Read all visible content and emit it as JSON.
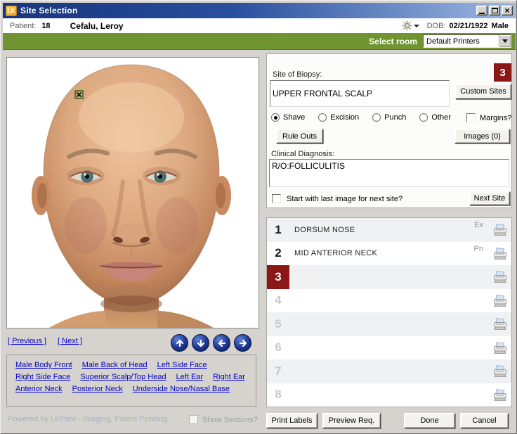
{
  "window": {
    "title": "Site Selection",
    "app_icon_text": "LK"
  },
  "patient_bar": {
    "patient_label": "Patient:",
    "patient_id": "18",
    "patient_name": "Cefalu, Leroy",
    "dob_label": "DOB:",
    "dob_value": "02/21/1922",
    "sex": "Male"
  },
  "room_bar": {
    "select_room_label": "Select room",
    "printer_value": "Default Printers"
  },
  "biopsy_form": {
    "site_of_biopsy_label": "Site of Biopsy:",
    "site_of_biopsy_value": "UPPER FRONTAL SCALP",
    "current_site_number": "3",
    "custom_sites_button": "Custom Sites",
    "procedure_options": [
      "Shave",
      "Excision",
      "Punch",
      "Other"
    ],
    "procedure_selected": "Shave",
    "margins_label": "Margins?",
    "margins_checked": false,
    "rule_outs_button": "Rule Outs",
    "images_button": "Images (0)",
    "clinical_diagnosis_label": "Clinical Diagnosis:",
    "clinical_diagnosis_value": "R/O:FOLLICULITIS",
    "start_with_last_image_label": "Start with last image for next site?",
    "start_with_last_image_checked": false,
    "next_site_button": "Next Site"
  },
  "site_list": {
    "rows": [
      {
        "num": "1",
        "site": "DORSUM NOSE",
        "procedure_code": "Ex",
        "state": "filled"
      },
      {
        "num": "2",
        "site": "MID ANTERIOR NECK",
        "procedure_code": "Pn",
        "state": "filled"
      },
      {
        "num": "3",
        "site": "",
        "procedure_code": "",
        "state": "selected"
      },
      {
        "num": "4",
        "site": "",
        "procedure_code": "",
        "state": "empty"
      },
      {
        "num": "5",
        "site": "",
        "procedure_code": "",
        "state": "empty"
      },
      {
        "num": "6",
        "site": "",
        "procedure_code": "",
        "state": "empty"
      },
      {
        "num": "7",
        "site": "",
        "procedure_code": "",
        "state": "empty"
      },
      {
        "num": "8",
        "site": "",
        "procedure_code": "",
        "state": "empty"
      }
    ]
  },
  "action_buttons": {
    "print_labels": "Print Labels",
    "preview_req": "Preview Req.",
    "done": "Done",
    "cancel": "Cancel"
  },
  "navigation": {
    "previous_link": "[ Previous ]",
    "next_link": "[ Next ]",
    "arrow_buttons": [
      "up",
      "down",
      "left",
      "right"
    ]
  },
  "region_links": [
    [
      "Male Body Front",
      "Male Back of Head",
      "Left Side Face"
    ],
    [
      "Right Side Face",
      "Superior Scalp/Top Head",
      "Left Ear",
      "Right Ear"
    ],
    [
      "Anterior Neck",
      "Posterior Neck",
      "Underside Nose/Nasal Base"
    ]
  ],
  "footer": {
    "powered_by": "Powered by LKPrint - Imaging. Patent Pending.",
    "show_sections_label": "Show Sections?",
    "show_sections_checked": false
  },
  "colors": {
    "titlebar_start": "#16357b",
    "titlebar_end": "#9cb8e2",
    "room_bar": "#6f9430",
    "selection_red": "#8b1717",
    "link_blue": "#0000cc",
    "window_bg": "#d6d3ce"
  }
}
